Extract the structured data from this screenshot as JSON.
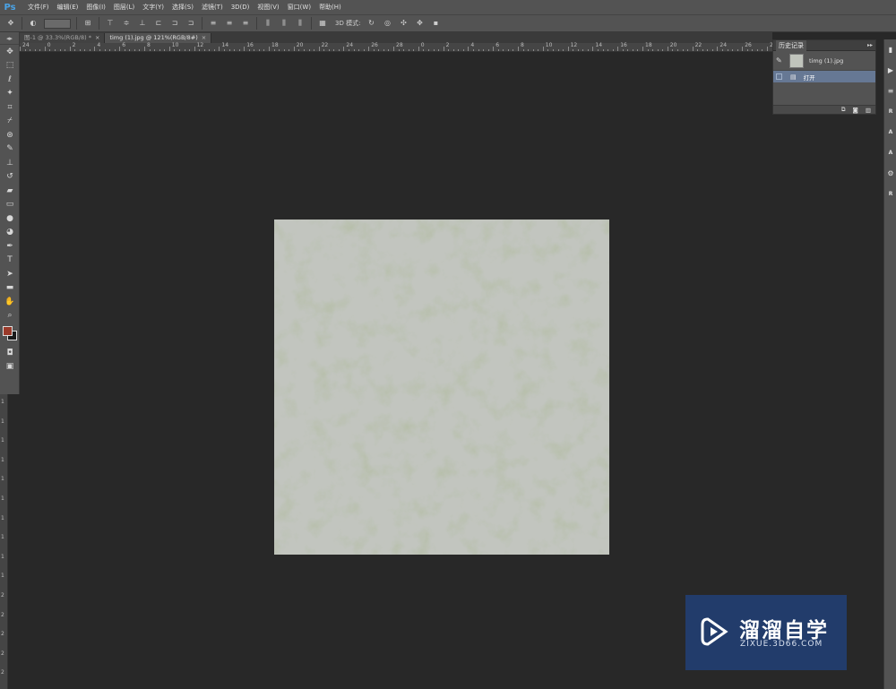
{
  "app": {
    "logo": "Ps"
  },
  "menu": [
    "文件(F)",
    "编辑(E)",
    "图像(I)",
    "图层(L)",
    "文字(Y)",
    "选择(S)",
    "滤镜(T)",
    "3D(D)",
    "视图(V)",
    "窗口(W)",
    "帮助(H)"
  ],
  "options_bar": {
    "mode_3d_label": "3D 模式:"
  },
  "tabs": [
    {
      "label": "图-1 @ 33.3%(RGB/8) *",
      "close": "×",
      "active": false
    },
    {
      "label": "timg (1).jpg @ 121%(RGB/8#)",
      "close": "×",
      "active": true
    }
  ],
  "ruler_top": [
    "24",
    "0",
    "2",
    "4",
    "6",
    "8",
    "10",
    "12",
    "14",
    "16",
    "18",
    "20",
    "22",
    "24",
    "26",
    "28",
    "0",
    "2",
    "4",
    "6",
    "8",
    "10",
    "12",
    "14",
    "16",
    "18",
    "20",
    "22",
    "24",
    "26",
    "27"
  ],
  "ruler_left": [
    "1",
    "1",
    "1",
    "1",
    "1",
    "1",
    "1",
    "1",
    "1",
    "1",
    "2",
    "2",
    "2",
    "2",
    "2"
  ],
  "tools": [
    "move-tool-icon",
    "marquee-tool-icon",
    "lasso-tool-icon",
    "magic-wand-tool-icon",
    "crop-tool-icon",
    "eyedropper-tool-icon",
    "spot-healing-tool-icon",
    "brush-tool-icon",
    "clone-stamp-tool-icon",
    "history-brush-tool-icon",
    "eraser-tool-icon",
    "gradient-tool-icon",
    "blur-tool-icon",
    "dodge-tool-icon",
    "pen-tool-icon",
    "type-tool-icon",
    "path-selection-tool-icon",
    "rectangle-tool-icon",
    "hand-tool-icon",
    "zoom-tool-icon"
  ],
  "colors": {
    "foreground": "#9a3a2a",
    "background": "#1a1a1a",
    "accent_selection": "#667894"
  },
  "history_panel": {
    "title": "历史记录",
    "collapse": "▸▸",
    "snapshot_label": "timg (1).jpg",
    "state_label": "打开"
  },
  "right_dock": [
    "R",
    "A",
    "A",
    "R"
  ],
  "watermark": {
    "brand": "溜溜自学",
    "url": "ZIXUE.3D66.COM"
  }
}
